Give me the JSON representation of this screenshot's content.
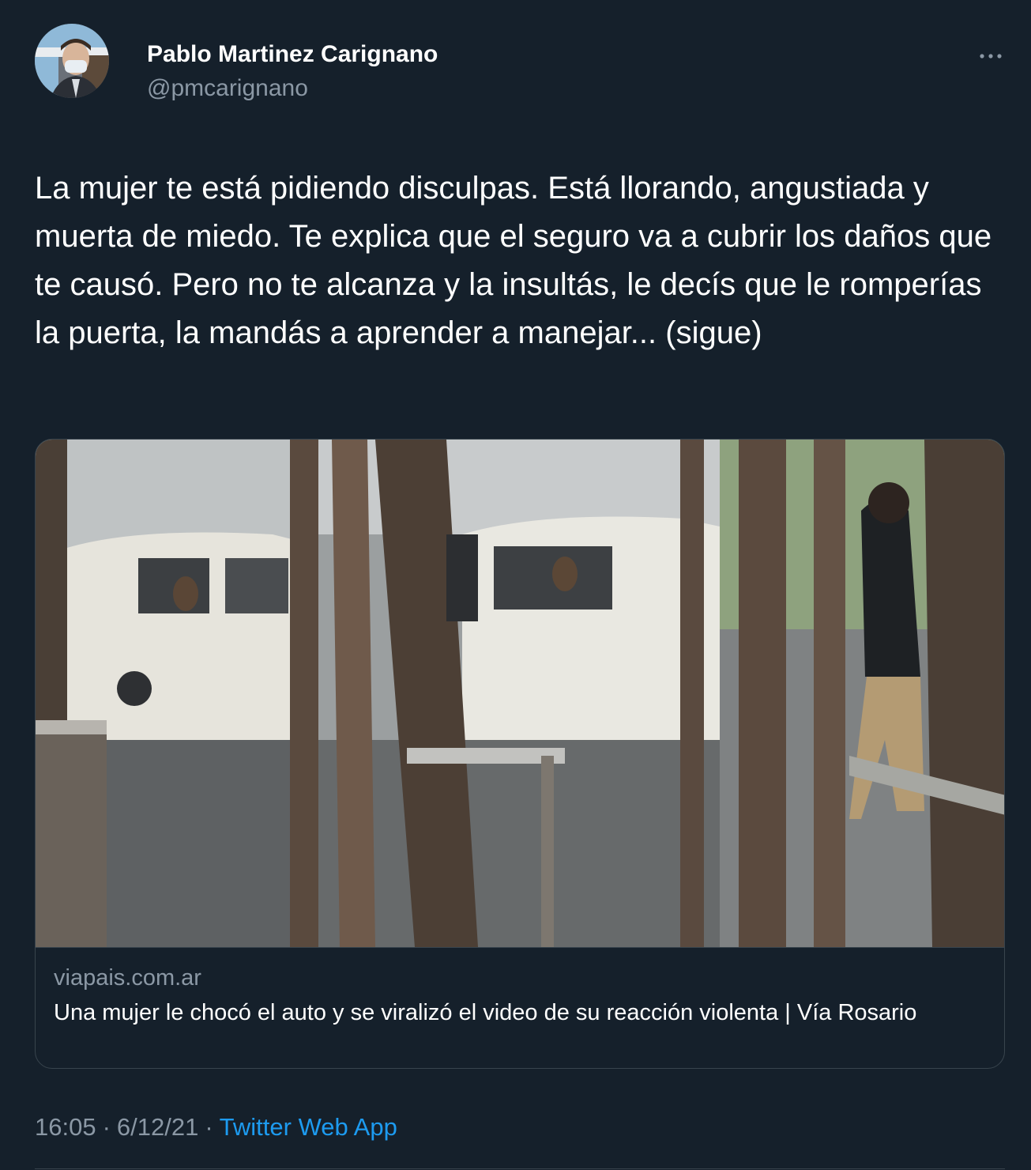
{
  "author": {
    "name": "Pablo Martinez Carignano",
    "handle": "@pmcarignano"
  },
  "more_icon": "ellipsis-icon",
  "tweet": {
    "text": "La mujer te está pidiendo disculpas. Está llorando, angustiada y muerta de miedo. Te explica que el seguro va a cubrir los daños que te causó. Pero no te alcanza y la insultás, le decís que le romperías la puerta, la mandás a aprender a manejar... (sigue)"
  },
  "card": {
    "domain": "viapais.com.ar",
    "title": "Una mujer le chocó el auto y se viralizó el video de su reacción violenta | Vía Rosario"
  },
  "footer": {
    "time": "16:05",
    "date": "6/12/21",
    "separator": "·",
    "source": "Twitter Web App"
  },
  "colors": {
    "background": "#15202b",
    "text_primary": "#ffffff",
    "text_secondary": "#8b98a5",
    "link": "#1d9bf0",
    "border": "#38444d"
  }
}
